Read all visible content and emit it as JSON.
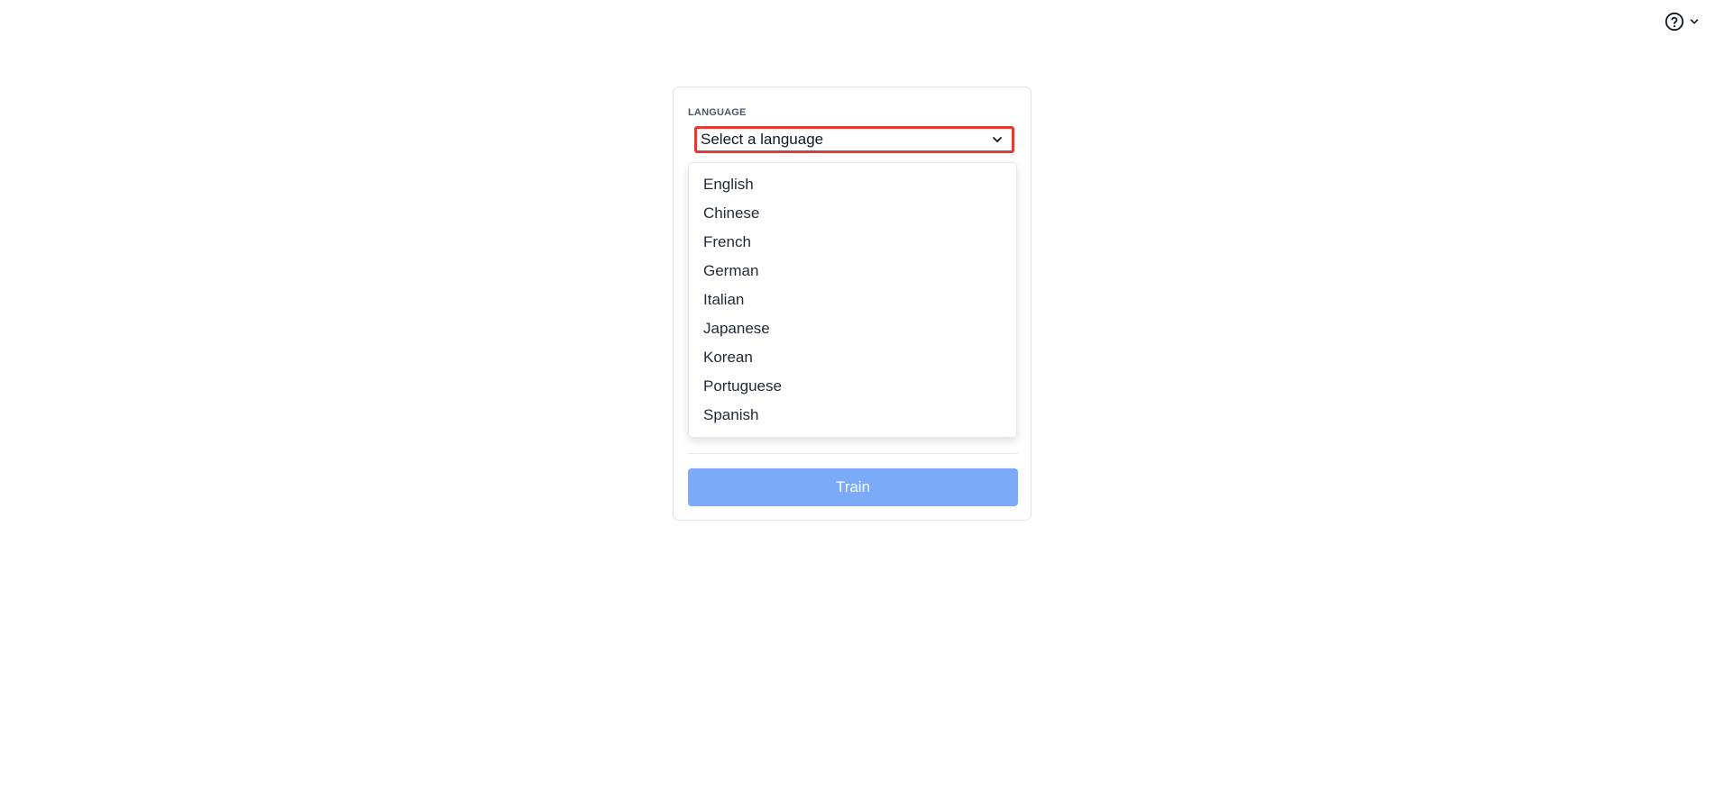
{
  "header": {
    "help_icon": "question-circle-icon",
    "help_chevron_icon": "chevron-down-icon"
  },
  "form": {
    "language_label": "LANGUAGE",
    "language_select": {
      "value": "Select a language",
      "chevron_icon": "chevron-down-icon",
      "highlight_color": "#e53935"
    },
    "dropdown_options": [
      "English",
      "Chinese",
      "French",
      "German",
      "Italian",
      "Japanese",
      "Korean",
      "Portuguese",
      "Spanish"
    ],
    "train_button": {
      "label": "Train",
      "color": "#7aaaf8"
    }
  }
}
